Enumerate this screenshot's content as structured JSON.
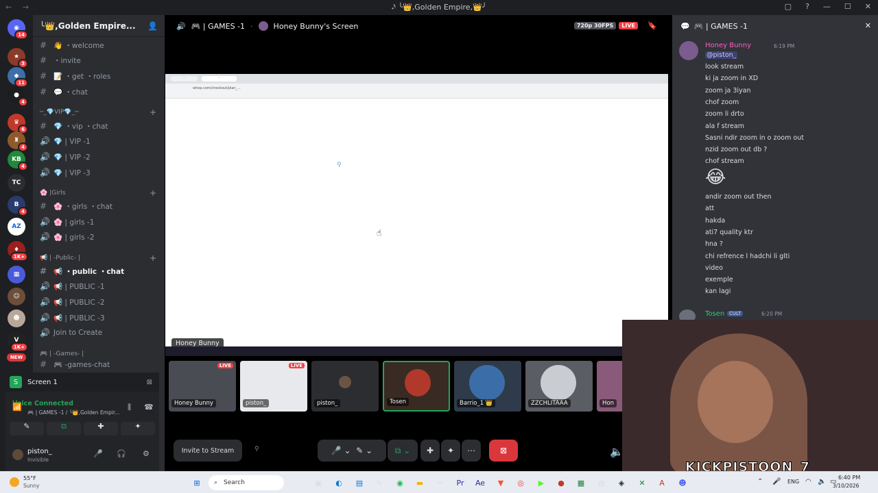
{
  "window": {
    "title": "𝆺𝅥𝅯 ╰👑,Golden Empire,👑╯"
  },
  "servers": {
    "badges": [
      "14",
      "3",
      "11",
      "4",
      "6",
      "4",
      "4",
      "4",
      "1K+",
      "1K+"
    ],
    "labels": {
      "tc": "TC",
      "az": "AZ",
      "new": "NEW"
    }
  },
  "sidebar": {
    "server_name": "╰👑,Golden Empire...",
    "channels": [
      {
        "name": "👋 ・welcome",
        "kind": "text"
      },
      {
        "name": "・invite",
        "kind": "link"
      },
      {
        "name": "📝 ・get ・roles",
        "kind": "text"
      },
      {
        "name": "💬 ・chat",
        "kind": "text"
      }
    ],
    "vip_category": "─_💎VIP💎_─",
    "vip_channels": [
      "💎 ・vip ・chat",
      "💎 | VIP -1",
      "💎 | VIP -2",
      "💎 | VIP -3"
    ],
    "girls_category": "🌸 |Girls",
    "girls_channels": [
      "🌸 ・girls ・chat",
      "🌸 | girls -1",
      "🌸 | girls -2"
    ],
    "public_category": "📢 | -Public- |",
    "public_channels": [
      "📢 ・public ・chat",
      "📢 | PUBLIC -1",
      "📢 | PUBLIC -2",
      "📢 | PUBLIC -3",
      "Join to Create"
    ],
    "games_category": "🎮 | -Games- |",
    "games_channel": "🎮 -games-chat"
  },
  "panel": {
    "screen_label": "Screen 1",
    "voice_status": "Voice Connected",
    "voice_location": "🎮 | GAMES -1 / ╰👑,Golden Empir...",
    "username": "piston_",
    "user_status": "Invisible"
  },
  "stage": {
    "channel": "🎮 | GAMES -1",
    "screen_title": "Honey Bunny's Screen",
    "quality": "720p 30FPS",
    "live": "LIVE",
    "presenter_tag": "Honey Bunny",
    "address_bar": "whop.com/checkout/plan_...",
    "tiles": [
      {
        "name": "Honey Bunny",
        "live": "LIVE"
      },
      {
        "name": "piston_",
        "live": "LIVE"
      },
      {
        "name": "piston_",
        "live": ""
      },
      {
        "name": "Tosen",
        "live": ""
      },
      {
        "name": "Barrio_1 👑",
        "live": ""
      },
      {
        "name": "ZZCHLITAAA",
        "live": ""
      },
      {
        "name": "Hon",
        "live": ""
      }
    ],
    "invite_label": "Invite to Stream"
  },
  "chat": {
    "title": "🎮 | GAMES -1",
    "author": "Honey Bunny",
    "time": "6:19 PM",
    "mention": "@piston_",
    "lines": [
      "look stream",
      "ki ja zoom in XD",
      "zoom ja 3iyan",
      "chof zoom",
      "zoom li drto",
      "ala f stream",
      "Sasni ndir zoom in o zoom out",
      "nzid zoom out db ?",
      "chof stream",
      "😂",
      "andir zoom out then",
      "att",
      "hakda",
      "ati7 quality ktr",
      "hna ?",
      "chi refrence l hadchi li glti",
      "video",
      "exemple",
      "kan lagi"
    ],
    "author2": "Tosen",
    "tag2": "CULT",
    "time2": "6:20 PM"
  },
  "webcam": {
    "overlay": "KICKPISTOON_7"
  },
  "taskbar": {
    "weather_temp": "55°F",
    "weather_desc": "Sunny",
    "search": "Search",
    "lang": "ENG",
    "time": "6:40 PM",
    "date": "3/10/2026"
  },
  "colors": {
    "live": "#f23f43",
    "green": "#23a559",
    "blurple": "#5865f2",
    "leave": "#da373c"
  }
}
